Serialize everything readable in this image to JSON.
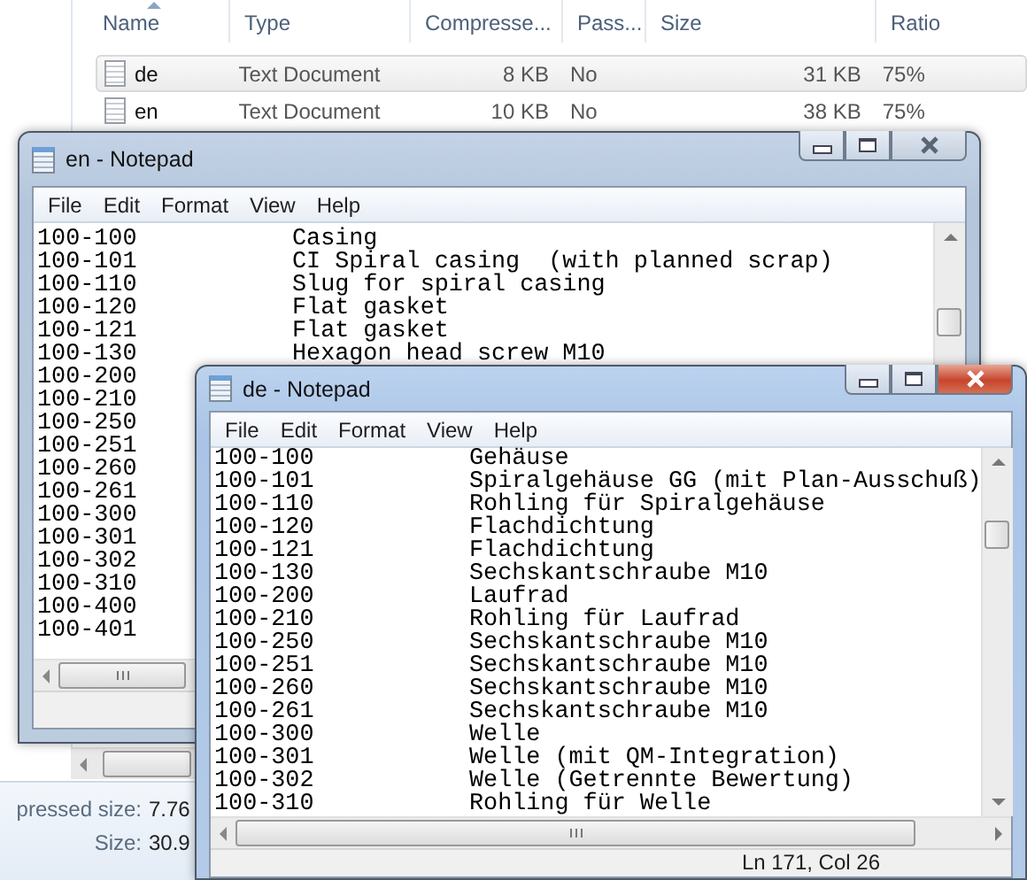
{
  "explorer": {
    "columns": [
      {
        "label": "Name",
        "sorted": true
      },
      {
        "label": "Type",
        "sorted": false
      },
      {
        "label": "Compresse...",
        "sorted": false
      },
      {
        "label": "Pass...",
        "sorted": false
      },
      {
        "label": "Size",
        "sorted": false
      },
      {
        "label": "Ratio",
        "sorted": false
      }
    ],
    "rows": [
      {
        "name": "de",
        "type": "Text Document",
        "compressed": "8 KB",
        "password": "No",
        "size": "31 KB",
        "ratio": "75%",
        "selected": true
      },
      {
        "name": "en",
        "type": "Text Document",
        "compressed": "10 KB",
        "password": "No",
        "size": "38 KB",
        "ratio": "75%",
        "selected": false
      }
    ],
    "details": [
      {
        "label": "pressed size:",
        "value": "7.76"
      },
      {
        "label": "Size:",
        "value": "30.9"
      }
    ]
  },
  "windows": [
    {
      "title": "en - Notepad",
      "active": false,
      "menu": [
        "File",
        "Edit",
        "Format",
        "View",
        "Help"
      ],
      "lines": [
        {
          "code": "100-100",
          "text": "Casing"
        },
        {
          "code": "100-101",
          "text": "CI Spiral casing  (with planned scrap)"
        },
        {
          "code": "100-110",
          "text": "Slug for spiral casing"
        },
        {
          "code": "100-120",
          "text": "Flat gasket"
        },
        {
          "code": "100-121",
          "text": "Flat gasket"
        },
        {
          "code": "100-130",
          "text": "Hexagon head screw M10"
        },
        {
          "code": "100-200"
        },
        {
          "code": "100-210"
        },
        {
          "code": "100-250"
        },
        {
          "code": "100-251"
        },
        {
          "code": "100-260"
        },
        {
          "code": "100-261"
        },
        {
          "code": "100-300"
        },
        {
          "code": "100-301"
        },
        {
          "code": "100-302"
        },
        {
          "code": "100-310"
        },
        {
          "code": "100-400"
        },
        {
          "code": "100-401"
        }
      ]
    },
    {
      "title": "de - Notepad",
      "active": true,
      "menu": [
        "File",
        "Edit",
        "Format",
        "View",
        "Help"
      ],
      "status": "Ln 171, Col 26",
      "lines": [
        {
          "code": "100-100",
          "text": "Gehäuse"
        },
        {
          "code": "100-101",
          "text": "Spiralgehäuse GG (mit Plan-Ausschuß)"
        },
        {
          "code": "100-110",
          "text": "Rohling für Spiralgehäuse"
        },
        {
          "code": "100-120",
          "text": "Flachdichtung"
        },
        {
          "code": "100-121",
          "text": "Flachdichtung"
        },
        {
          "code": "100-130",
          "text": "Sechskantschraube M10"
        },
        {
          "code": "100-200",
          "text": "Laufrad"
        },
        {
          "code": "100-210",
          "text": "Rohling für Laufrad"
        },
        {
          "code": "100-250",
          "text": "Sechskantschraube M10"
        },
        {
          "code": "100-251",
          "text": "Sechskantschraube M10"
        },
        {
          "code": "100-260",
          "text": "Sechskantschraube M10"
        },
        {
          "code": "100-261",
          "text": "Sechskantschraube M10"
        },
        {
          "code": "100-300",
          "text": "Welle"
        },
        {
          "code": "100-301",
          "text": "Welle (mit QM-Integration)"
        },
        {
          "code": "100-302",
          "text": "Welle (Getrennte Bewertung)"
        },
        {
          "code": "100-310",
          "text": "Rohling für Welle"
        }
      ]
    }
  ]
}
